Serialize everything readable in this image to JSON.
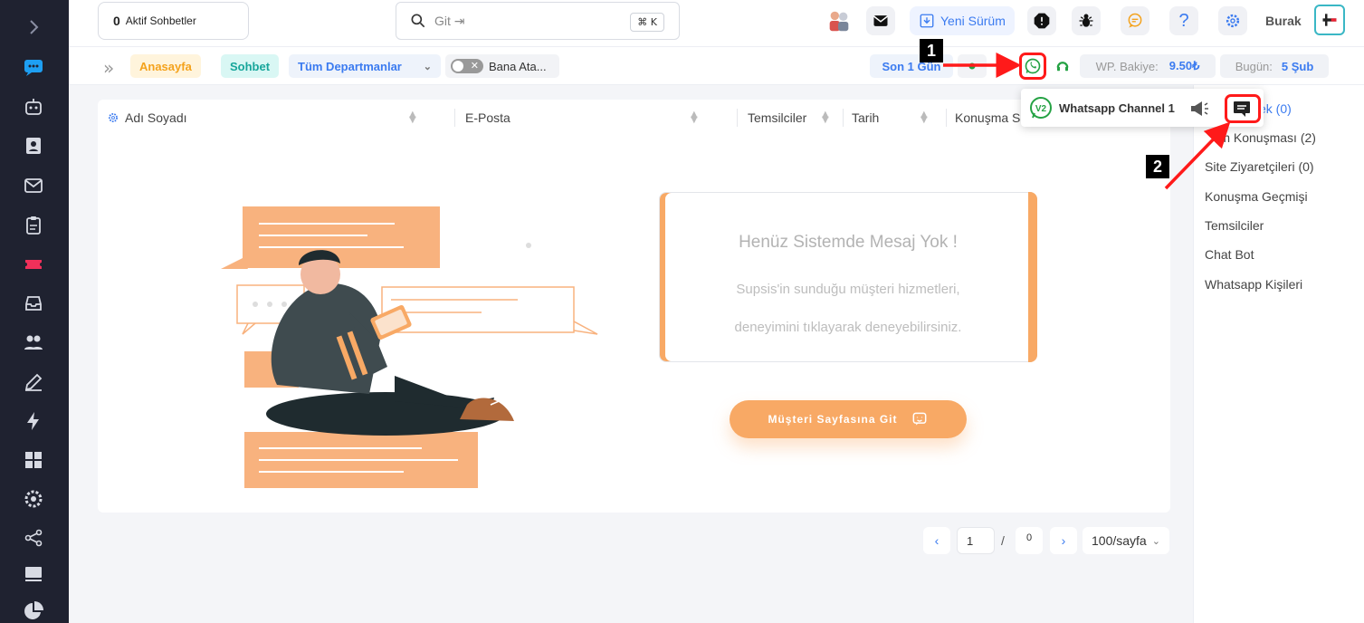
{
  "topbar": {
    "active_count": "0",
    "active_label": "Aktif Sohbetler",
    "search_placeholder": "Git ⇥",
    "search_shortcut": "⌘ K",
    "new_version": "Yeni Sürüm",
    "username": "Burak"
  },
  "subbar": {
    "home": "Anasayfa",
    "chat": "Sohbet",
    "department": "Tüm Departmanlar",
    "assign_toggle": "Bana Ata...",
    "last_day": "Son 1 Gün",
    "wp_balance_label": "WP. Bakiye:",
    "wp_balance_value": "9.50₺",
    "today_label": "Bugün:",
    "today_value": "5 Şub"
  },
  "table": {
    "columns": [
      "Adı Soyadı",
      "E-Posta",
      "Temsilciler",
      "Tarih",
      "Konuşma S"
    ]
  },
  "empty_state": {
    "title": "Henüz Sistemde Mesaj Yok !",
    "line1": "Supsis'in sunduğu müşteri hizmetleri,",
    "line2": "deneyimini tıklayarak deneyebilirsiniz.",
    "button": "Müşteri Sayfasına Git"
  },
  "pagination": {
    "current": "1",
    "separator": "/",
    "total": "0",
    "page_size": "100/sayfa"
  },
  "right_panel": {
    "items": [
      {
        "label": "Bekleyen (0)",
        "visible": "ek (0)"
      },
      {
        "label": "Tüm Konuşması (2)",
        "visible": "m Konuşması (2)"
      },
      {
        "label": "Site Ziyaretçileri (0)"
      },
      {
        "label": "Konuşma Geçmişi"
      },
      {
        "label": "Temsilciler"
      },
      {
        "label": "Chat Bot"
      },
      {
        "label": "Whatsapp Kişileri"
      }
    ]
  },
  "popup": {
    "badge": "V2",
    "channel_name": "Whatsapp Channel 1"
  },
  "annotations": {
    "step1": "1",
    "step2": "2"
  },
  "colors": {
    "sidebar_bg": "#1f2230",
    "accent_blue": "#3b7bf0",
    "accent_orange": "#f8a965",
    "whatsapp_green": "#25a244",
    "annotation_red": "#ff1a1a"
  }
}
